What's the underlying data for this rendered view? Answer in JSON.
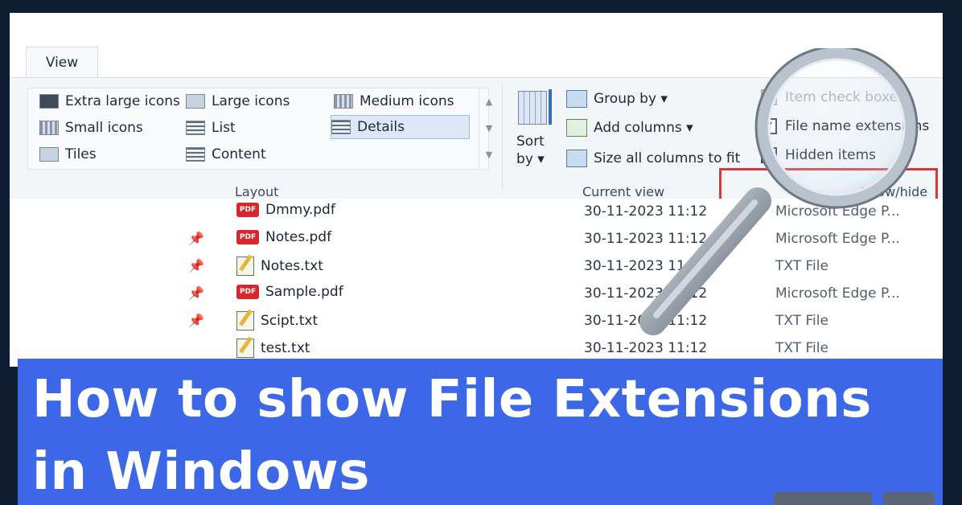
{
  "explorer": {
    "tab_label": "View",
    "layout": {
      "group_label": "Layout",
      "items": [
        {
          "label": "Extra large icons",
          "icon": "extra-large-icons-icon"
        },
        {
          "label": "Large icons",
          "icon": "large-icons-icon"
        },
        {
          "label": "Medium icons",
          "icon": "medium-icons-icon"
        },
        {
          "label": "Small icons",
          "icon": "small-icons-icon"
        },
        {
          "label": "List",
          "icon": "list-icon"
        },
        {
          "label": "Details",
          "icon": "details-icon",
          "selected": true
        },
        {
          "label": "Tiles",
          "icon": "tiles-icon"
        },
        {
          "label": "Content",
          "icon": "content-icon"
        }
      ]
    },
    "current_view": {
      "group_label": "Current view",
      "sort_label_1": "Sort",
      "sort_label_2": "by ▾",
      "group_by": "Group by ▾",
      "add_columns": "Add columns ▾",
      "size_columns": "Size all columns to fit"
    },
    "show_hide": {
      "group_label": "Show/hide",
      "items": [
        {
          "label": "Item check boxes",
          "checked": false
        },
        {
          "label": "File name extensions",
          "checked": true
        },
        {
          "label": "Hidden items",
          "checked": true
        }
      ]
    },
    "files": [
      {
        "name": "Dmmy.pdf",
        "date": "30-11-2023 11:12",
        "type": "Microsoft Edge P...",
        "kind": "pdf",
        "pinned": false
      },
      {
        "name": "Notes.pdf",
        "date": "30-11-2023 11:12",
        "type": "Microsoft Edge P...",
        "kind": "pdf",
        "pinned": true
      },
      {
        "name": "Notes.txt",
        "date": "30-11-2023 11:12",
        "type": "TXT File",
        "kind": "txt",
        "pinned": true
      },
      {
        "name": "Sample.pdf",
        "date": "30-11-2023 11:12",
        "type": "Microsoft Edge P...",
        "kind": "pdf",
        "pinned": true
      },
      {
        "name": "Scipt.txt",
        "date": "30-11-2023 11:12",
        "type": "TXT File",
        "kind": "txt",
        "pinned": true
      },
      {
        "name": "test.txt",
        "date": "30-11-2023 11:12",
        "type": "TXT File",
        "kind": "txt",
        "pinned": false
      }
    ],
    "pdf_badge": "PDF",
    "check_mark": "✓",
    "pin_glyph": "📌"
  },
  "banner": {
    "title_line1": "How to show File Extensions",
    "title_line2": "in Windows"
  },
  "colors": {
    "banner_bg": "#3c68e8",
    "highlight_border": "#d33a3a",
    "page_bg": "#0f1d33"
  }
}
